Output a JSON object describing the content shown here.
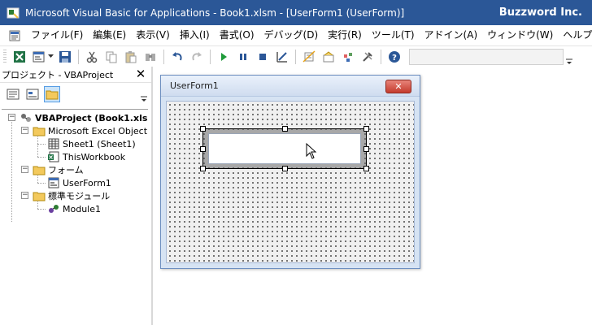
{
  "window": {
    "title": "Microsoft Visual Basic for Applications - Book1.xlsm - [UserForm1 (UserForm)]",
    "brand": "Buzzword Inc."
  },
  "menu": {
    "items": [
      {
        "label": "ファイル(F)"
      },
      {
        "label": "編集(E)"
      },
      {
        "label": "表示(V)"
      },
      {
        "label": "挿入(I)"
      },
      {
        "label": "書式(O)"
      },
      {
        "label": "デバッグ(D)"
      },
      {
        "label": "実行(R)"
      },
      {
        "label": "ツール(T)"
      },
      {
        "label": "アドイン(A)"
      },
      {
        "label": "ウィンドウ(W)"
      },
      {
        "label": "ヘルプ(H)"
      }
    ]
  },
  "toolbar": {
    "buttons": [
      "excel-icon",
      "insert-userform-icon",
      "save-icon",
      "cut-icon",
      "copy-icon",
      "paste-icon",
      "find-icon",
      "undo-icon",
      "redo-icon",
      "run-icon",
      "break-icon",
      "reset-icon",
      "design-mode-icon",
      "project-explorer-icon",
      "properties-icon",
      "object-browser-icon",
      "toolbox-icon",
      "help-icon"
    ]
  },
  "project": {
    "title": "プロジェクト - VBAProject",
    "close_glyph": "✕",
    "tree": [
      {
        "label": "VBAProject (Book1.xls",
        "icon": "vbaproject-icon",
        "level": 0,
        "expander": "−"
      },
      {
        "label": "Microsoft Excel Object",
        "icon": "folder-icon",
        "level": 1,
        "expander": "−"
      },
      {
        "label": "Sheet1 (Sheet1)",
        "icon": "sheet-icon",
        "level": 2
      },
      {
        "label": "ThisWorkbook",
        "icon": "workbook-icon",
        "level": 2
      },
      {
        "label": "フォーム",
        "icon": "folder-icon",
        "level": 1,
        "expander": "−"
      },
      {
        "label": "UserForm1",
        "icon": "userform-icon",
        "level": 2
      },
      {
        "label": "標準モジュール",
        "icon": "folder-icon",
        "level": 1,
        "expander": "−"
      },
      {
        "label": "Module1",
        "icon": "module-icon",
        "level": 2
      }
    ]
  },
  "designer": {
    "form_title": "UserForm1",
    "close_glyph": "✕"
  },
  "colors": {
    "titlebar": "#2b5797",
    "selection_highlight": "#cce4f7"
  }
}
